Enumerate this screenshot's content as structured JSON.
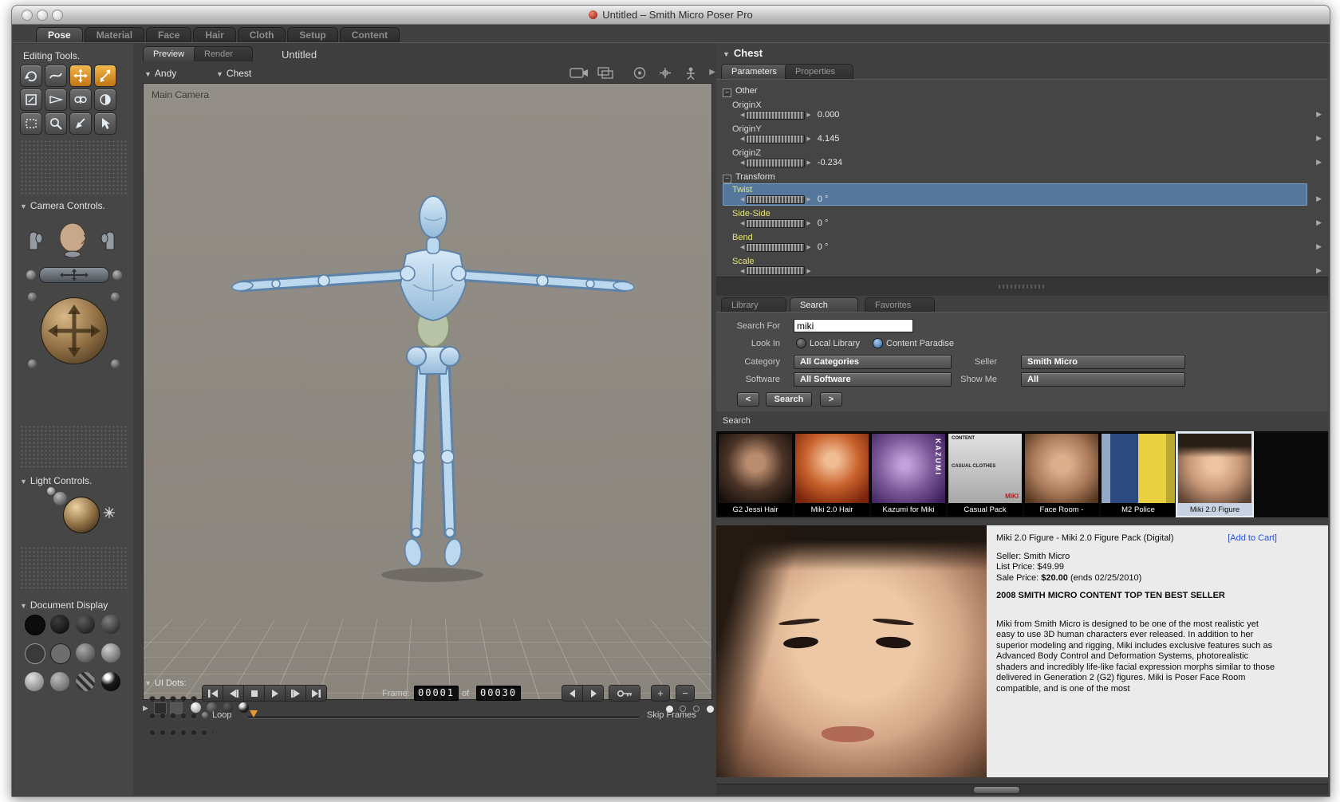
{
  "window": {
    "title": "Untitled – Smith Micro Poser Pro"
  },
  "icons": {
    "collapse": "▼",
    "expand": "▶",
    "dial_left": "◀",
    "dial_right": "▶",
    "minus": "−",
    "plus": "+"
  },
  "room_tabs": {
    "items": [
      {
        "label": "Pose"
      },
      {
        "label": "Material"
      },
      {
        "label": "Face"
      },
      {
        "label": "Hair"
      },
      {
        "label": "Cloth"
      },
      {
        "label": "Setup"
      },
      {
        "label": "Content"
      }
    ]
  },
  "sidebar": {
    "editing_tools": "Editing Tools.",
    "camera_controls": "Camera Controls.",
    "light_controls": "Light Controls.",
    "document_display": "Document Display"
  },
  "document": {
    "preview_tab": "Preview",
    "render_tab": "Render",
    "title": "Untitled",
    "figure": "Andy",
    "actor": "Chest",
    "camera_label": "Main Camera",
    "ui_dots": "UI Dots:"
  },
  "playback": {
    "frame_label": "Frame:",
    "current": "00001",
    "of": "of",
    "total": "00030",
    "loop": "Loop",
    "skip_frames": "Skip Frames"
  },
  "parameters": {
    "header": "Chest",
    "tabs": {
      "parameters": "Parameters",
      "properties": "Properties"
    },
    "groups": {
      "other": {
        "name": "Other",
        "params": [
          {
            "label": "OriginX",
            "value": "0.000"
          },
          {
            "label": "OriginY",
            "value": "4.145"
          },
          {
            "label": "OriginZ",
            "value": "-0.234"
          }
        ]
      },
      "transform": {
        "name": "Transform",
        "params": [
          {
            "label": "Twist",
            "value": "0 °"
          },
          {
            "label": "Side-Side",
            "value": "0 °"
          },
          {
            "label": "Bend",
            "value": "0 °"
          },
          {
            "label": "Scale",
            "value": ""
          }
        ]
      }
    }
  },
  "library": {
    "tabs": {
      "library": "Library",
      "search": "Search",
      "favorites": "Favorites"
    },
    "form": {
      "search_for_label": "Search For",
      "search_value": "miki",
      "look_in_label": "Look In",
      "local_library": "Local Library",
      "content_paradise": "Content Paradise",
      "category_label": "Category",
      "category_value": "All Categories",
      "seller_label": "Seller",
      "seller_value": "Smith Micro",
      "software_label": "Software",
      "software_value": "All Software",
      "show_me_label": "Show Me",
      "show_me_value": "All",
      "prev": "<",
      "search_button": "Search",
      "next": ">"
    },
    "results_label": "Search",
    "results": [
      {
        "caption": "G2 Jessi Hair"
      },
      {
        "caption": "Miki 2.0 Hair"
      },
      {
        "caption": "Kazumi for Miki",
        "overlay": "KAZUMI"
      },
      {
        "caption": "Casual Pack",
        "overlay_top": "CONTENT",
        "overlay_mid": "CASUAL CLOTHES",
        "overlay_brand": "MIKI"
      },
      {
        "caption": "Face Room -"
      },
      {
        "caption": "M2 Police"
      },
      {
        "caption": "Miki 2.0 Figure"
      }
    ],
    "detail": {
      "title": "Miki 2.0 Figure - Miki 2.0 Figure Pack (Digital)",
      "add_to_cart": "[Add to Cart]",
      "seller": "Seller: Smith Micro",
      "list_price": "List Price: $49.99",
      "sale_prefix": "Sale Price: ",
      "sale_amount": "$20.00",
      "sale_suffix": " (ends 02/25/2010)",
      "banner": "2008 SMITH MICRO CONTENT TOP TEN BEST SELLER",
      "description": "Miki from Smith Micro is designed to be one of the most realistic yet easy to use 3D human characters ever released. In addition to her superior modeling and rigging, Miki includes exclusive features such as Advanced Body Control and Deformation Systems, photorealistic shaders and incredibly life-like facial expression morphs similar to those delivered in Generation 2 (G2) figures. Miki is Poser Face Room compatible, and is one of the most"
    }
  },
  "colors": {
    "accent_orange": "#e89a2e",
    "selection_blue": "#56779c",
    "param_yellow": "#e3e379",
    "link_blue": "#2b4fd4",
    "figure_blue": "#b9d6ec"
  }
}
